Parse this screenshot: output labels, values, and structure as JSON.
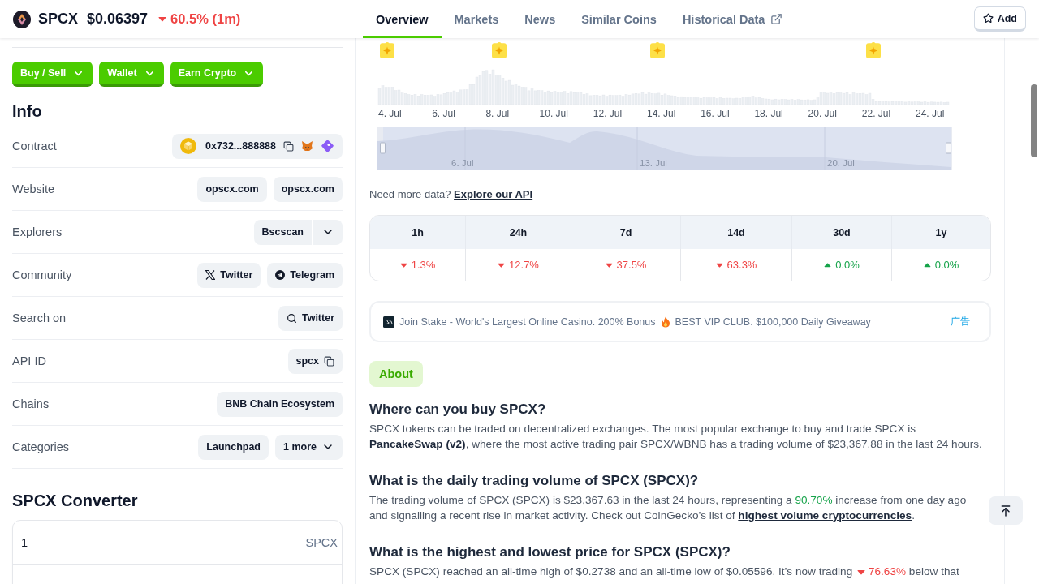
{
  "coin": {
    "symbol": "SPCX",
    "price": "$0.06397",
    "change": "60.5% (1m)",
    "rising": false
  },
  "tabs": [
    {
      "label": "Overview",
      "selected": true,
      "external": false
    },
    {
      "label": "Markets",
      "selected": false,
      "external": false
    },
    {
      "label": "News",
      "selected": false,
      "external": false
    },
    {
      "label": "Similar Coins",
      "selected": false,
      "external": false
    },
    {
      "label": "Historical Data",
      "selected": false,
      "external": true
    }
  ],
  "add_button": {
    "label": "Add"
  },
  "action_buttons": [
    "Buy / Sell",
    "Wallet",
    "Earn Crypto"
  ],
  "info": {
    "title": "Info",
    "rows": [
      {
        "label": "Contract",
        "items": [
          {
            "kind": "contract",
            "text": "0x732...888888"
          }
        ]
      },
      {
        "label": "Website",
        "items": [
          {
            "kind": "plain",
            "text": "opscx.com"
          },
          {
            "kind": "plain",
            "text": "opscx.com"
          }
        ]
      },
      {
        "label": "Explorers",
        "items": [
          {
            "kind": "split",
            "text": "Bscscan"
          }
        ]
      },
      {
        "label": "Community",
        "items": [
          {
            "kind": "x",
            "text": "Twitter"
          },
          {
            "kind": "telegram",
            "text": "Telegram"
          }
        ]
      },
      {
        "label": "Search on",
        "items": [
          {
            "kind": "search",
            "text": "Twitter"
          }
        ]
      },
      {
        "label": "API ID",
        "items": [
          {
            "kind": "copy",
            "text": "spcx"
          }
        ]
      },
      {
        "label": "Chains",
        "items": [
          {
            "kind": "plain",
            "text": "BNB Chain Ecosystem"
          }
        ]
      },
      {
        "label": "Categories",
        "items": [
          {
            "kind": "plain",
            "text": "Launchpad"
          },
          {
            "kind": "more",
            "text": "1 more"
          }
        ]
      }
    ]
  },
  "converter": {
    "title": "SPCX Converter",
    "amount": "1",
    "unit": "SPCX"
  },
  "chart": {
    "x_labels": [
      "4. Jul",
      "6. Jul",
      "8. Jul",
      "10. Jul",
      "12. Jul",
      "14. Jul",
      "16. Jul",
      "18. Jul",
      "20. Jul",
      "22. Jul",
      "24. Jul"
    ],
    "navigator_labels": [
      "6. Jul",
      "13. Jul",
      "20. Jul"
    ]
  },
  "api_note": {
    "text": "Need more data?",
    "link": "Explore our API"
  },
  "performance": [
    {
      "period": "1h",
      "change": "1.3%",
      "rising": false
    },
    {
      "period": "24h",
      "change": "12.7%",
      "rising": false
    },
    {
      "period": "7d",
      "change": "37.5%",
      "rising": false
    },
    {
      "period": "14d",
      "change": "63.3%",
      "rising": false
    },
    {
      "period": "30d",
      "change": "0.0%",
      "rising": true
    },
    {
      "period": "1y",
      "change": "0.0%",
      "rising": true
    }
  ],
  "ad": {
    "text": "Join Stake - World's Largest Online Casino. 200% Bonus",
    "text_after": "BEST VIP CLUB. $100,000 Daily Giveaway",
    "badge": "广告"
  },
  "about": {
    "label": "About",
    "sections": [
      {
        "question": "Where can you buy SPCX?",
        "answer": [
          {
            "kind": "text",
            "text": "SPCX tokens can be traded on decentralized exchanges. The most popular exchange to buy and trade SPCX is "
          },
          {
            "kind": "link",
            "text": "PancakeSwap (v2)"
          },
          {
            "kind": "text",
            "text": ", where the most active trading pair SPCX/WBNB has a trading volume of $23,367.88 in the last 24 hours."
          }
        ]
      },
      {
        "question": "What is the daily trading volume of SPCX (SPCX)?",
        "answer": [
          {
            "kind": "text",
            "text": "The trading volume of SPCX (SPCX) is $23,367.63 in the last 24 hours, representing a "
          },
          {
            "kind": "up",
            "text": "90.70%"
          },
          {
            "kind": "text",
            "text": " increase from one day ago and signalling a recent rise in market activity. Check out CoinGecko’s list of "
          },
          {
            "kind": "link",
            "text": "highest volume cryptocurrencies"
          },
          {
            "kind": "text",
            "text": "."
          }
        ]
      },
      {
        "question": "What is the highest and lowest price for SPCX (SPCX)?",
        "answer": [
          {
            "kind": "text",
            "text": "SPCX (SPCX) reached an all-time high of $0.2738 and an all-time low of $0.05596. It’s now trading "
          },
          {
            "kind": "down",
            "text": "76.63%"
          },
          {
            "kind": "text",
            "text": " below that"
          }
        ]
      }
    ]
  }
}
